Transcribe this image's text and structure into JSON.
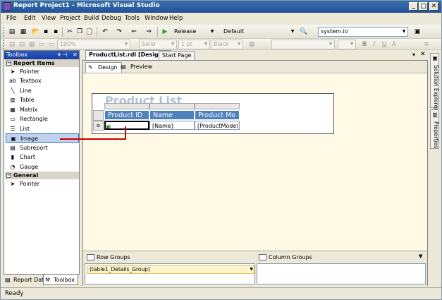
{
  "window": {
    "title": "Report Project1 - Microsoft Visual Studio"
  },
  "menu": [
    "File",
    "Edit",
    "View",
    "Project",
    "Build",
    "Debug",
    "Tools",
    "Window",
    "Help"
  ],
  "toolbar1": {
    "config": "Release",
    "platform": "Default",
    "search": "system.io"
  },
  "toolbar2": {
    "zoom": "100%",
    "line_style": "Solid",
    "line_width": "1 pt",
    "color": "Black",
    "bold": "B",
    "italic": "I",
    "underline": "U",
    "font_color": "A"
  },
  "toolbox": {
    "title": "Toolbox",
    "pin": "▾ ⊣",
    "close": "✕",
    "groups": [
      {
        "name": "Report Items",
        "items": [
          "Pointer",
          "Textbox",
          "Line",
          "Table",
          "Matrix",
          "Rectangle",
          "List",
          "Image",
          "Subreport",
          "Chart",
          "Gauge"
        ]
      },
      {
        "name": "General",
        "items": [
          "Pointer"
        ]
      }
    ],
    "selected_item": "Image",
    "bottom_tabs": [
      "Report Data",
      "Toolbox"
    ]
  },
  "document_tabs": [
    "ProductList.rdl [Design]*",
    "Start Page"
  ],
  "designer_tabs": [
    "Design",
    "Preview"
  ],
  "report": {
    "title": "Product List",
    "headers": [
      "Product ID",
      "Name",
      "Product Mo"
    ],
    "row": [
      "",
      "[Name]",
      "[ProductModel]"
    ]
  },
  "groups": {
    "row_label": "Row Groups",
    "col_label": "Column Groups",
    "row_item": "(table1_Details_Group)"
  },
  "right_dock": [
    "Solution Explorer",
    "Properties"
  ],
  "status": "Ready",
  "colors": {
    "header_fill": "#4f81bd",
    "selection": "#c1d2ee",
    "arrow": "#cc0000"
  }
}
